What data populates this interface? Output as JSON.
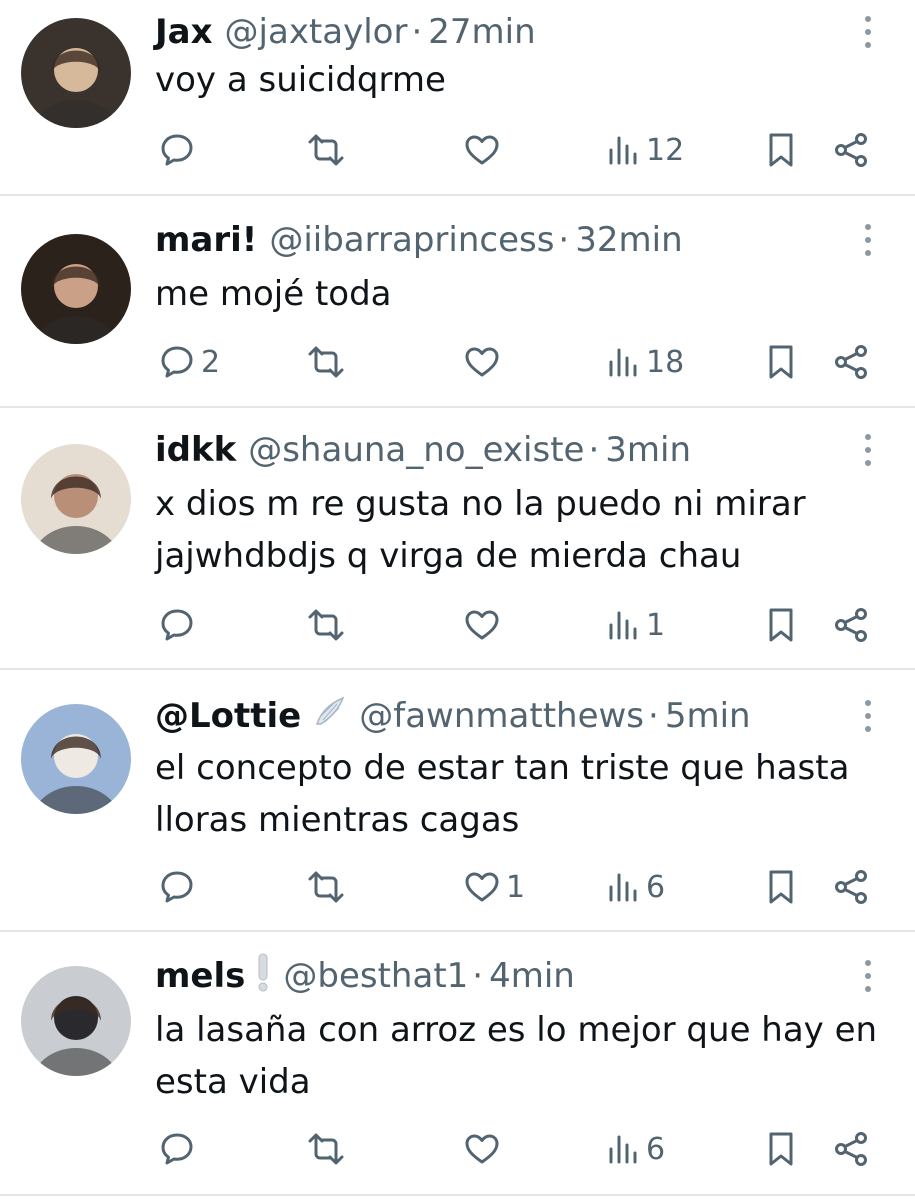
{
  "tweets": [
    {
      "name": "Jax",
      "handle": "@jaxtaylor",
      "sep": "·",
      "time": "27min",
      "badge": "",
      "text": "voy a suicidqrme",
      "counts": {
        "reply": "",
        "retweet": "",
        "like": "",
        "views": "12"
      },
      "avatar_colors": [
        "#3a332d",
        "#d6b89a"
      ]
    },
    {
      "name": "mari!",
      "handle": "@iibarraprincess",
      "sep": "·",
      "time": "32min",
      "badge": "",
      "text": "me mojé toda",
      "counts": {
        "reply": "2",
        "retweet": "",
        "like": "",
        "views": "18"
      },
      "avatar_colors": [
        "#2c221c",
        "#caa187"
      ]
    },
    {
      "name": "idkk",
      "handle": "@shauna_no_existe",
      "sep": "·",
      "time": "3min",
      "badge": "",
      "text": "x dios m re gusta no la puedo ni mirar\njajwhdbdjs q virga de mierda chau",
      "counts": {
        "reply": "",
        "retweet": "",
        "like": "",
        "views": "1"
      },
      "avatar_colors": [
        "#e6ddd2",
        "#b98f77"
      ]
    },
    {
      "name": "@Lottie",
      "handle": "@fawnmatthews",
      "sep": "·",
      "time": "5min",
      "badge": "wing-badge-icon",
      "text": "el concepto de estar tan triste que hasta\nlloras mientras cagas",
      "counts": {
        "reply": "",
        "retweet": "",
        "like": "1",
        "views": "6"
      },
      "avatar_colors": [
        "#9ab4d8",
        "#efe9e4"
      ]
    },
    {
      "name": "mels",
      "handle": "@besthat1",
      "sep": "·",
      "time": "4min",
      "badge": "exclamation-badge-icon",
      "text": "la lasaña con arroz es lo mejor que hay en\nesta vida",
      "counts": {
        "reply": "",
        "retweet": "",
        "like": "",
        "views": "6"
      },
      "avatar_colors": [
        "#c9ccd0",
        "#2a2a2e"
      ]
    }
  ],
  "icons": {
    "reply": "reply-icon",
    "retweet": "retweet-icon",
    "like": "like-icon",
    "views": "views-icon",
    "bookmark": "bookmark-icon",
    "share": "share-icon",
    "more": "more-icon"
  },
  "colors": {
    "text": "#0f1419",
    "muted": "#536471",
    "divider": "#e3e6e9"
  }
}
